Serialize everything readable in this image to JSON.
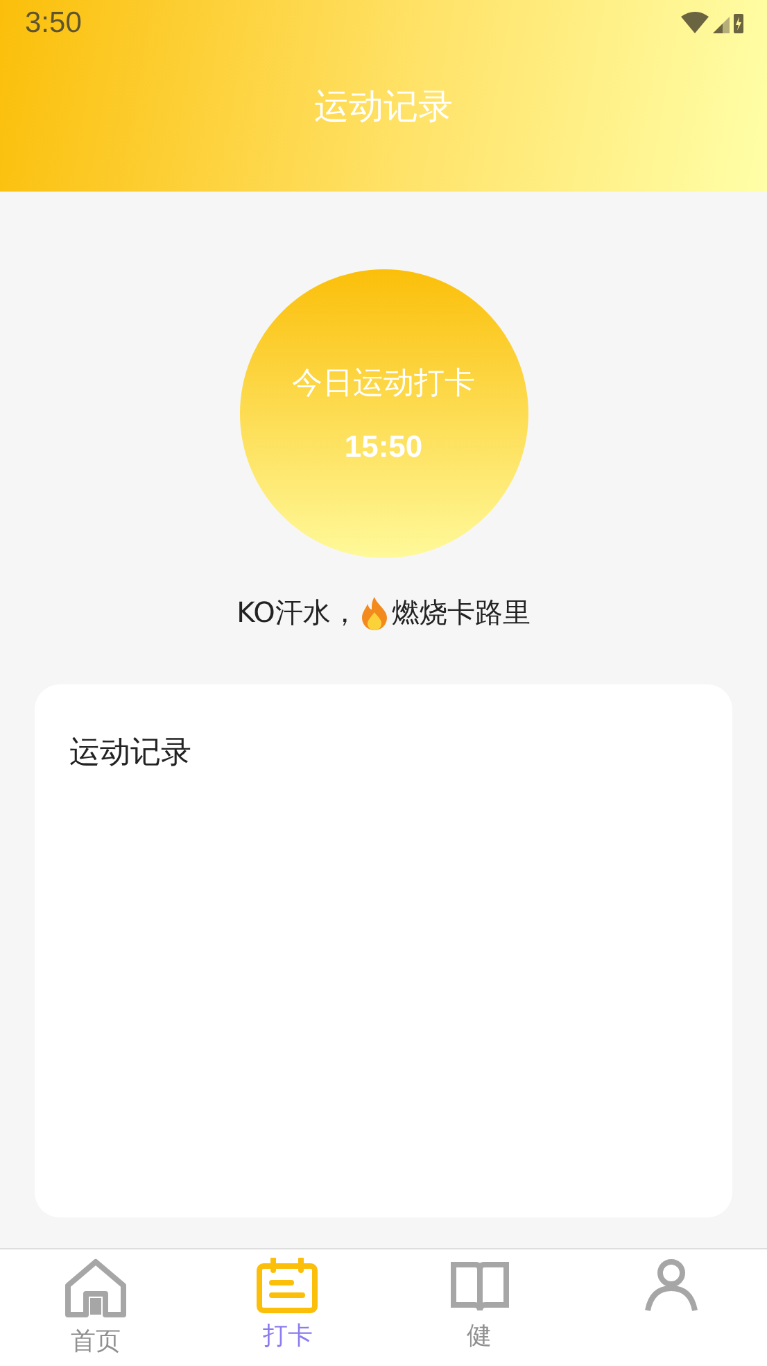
{
  "status_bar": {
    "time": "3:50"
  },
  "header": {
    "title": "运动记录"
  },
  "checkin": {
    "label": "今日运动打卡",
    "time": "15:50"
  },
  "slogan": {
    "before": "KO汗水，",
    "after": "燃烧卡路里"
  },
  "record_card": {
    "title": "运动记录"
  },
  "tabs": [
    {
      "kind": "home",
      "label": "首页",
      "selected": false
    },
    {
      "kind": "calendar",
      "label": "打卡",
      "selected": true
    },
    {
      "kind": "book",
      "label": "健",
      "selected": false
    },
    {
      "kind": "person",
      "selected": false
    }
  ]
}
